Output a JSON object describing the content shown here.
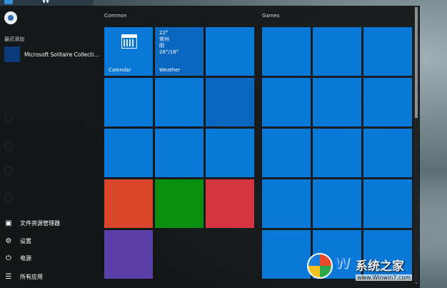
{
  "taskbar": {
    "app_letter": "W"
  },
  "left": {
    "recent_label": "最近添加",
    "recent_app": "Microsoft Solitaire Collecti...",
    "bottom_items": [
      {
        "label": "文件资源管理器",
        "icon": "folder-icon"
      },
      {
        "label": "设置",
        "icon": "gear-icon"
      },
      {
        "label": "电源",
        "icon": "power-icon"
      },
      {
        "label": "所有应用",
        "icon": "list-icon"
      }
    ]
  },
  "groups": {
    "common": "Common",
    "games": "Games"
  },
  "tiles": {
    "calendar": {
      "label": "Calendar"
    },
    "weather": {
      "label": "Weather",
      "temp": "22°",
      "city": "常州",
      "condition": "阴",
      "range": "28°/18°"
    }
  },
  "colors": {
    "tile_blue": "#0a78d7",
    "tile_orange": "#d9472b",
    "tile_green": "#0a8f10",
    "tile_red": "#d23540",
    "tile_purple": "#5b3fa8"
  },
  "watermark": {
    "letter": "W",
    "text": "系统之家",
    "url": "www.Winwin7.com"
  }
}
